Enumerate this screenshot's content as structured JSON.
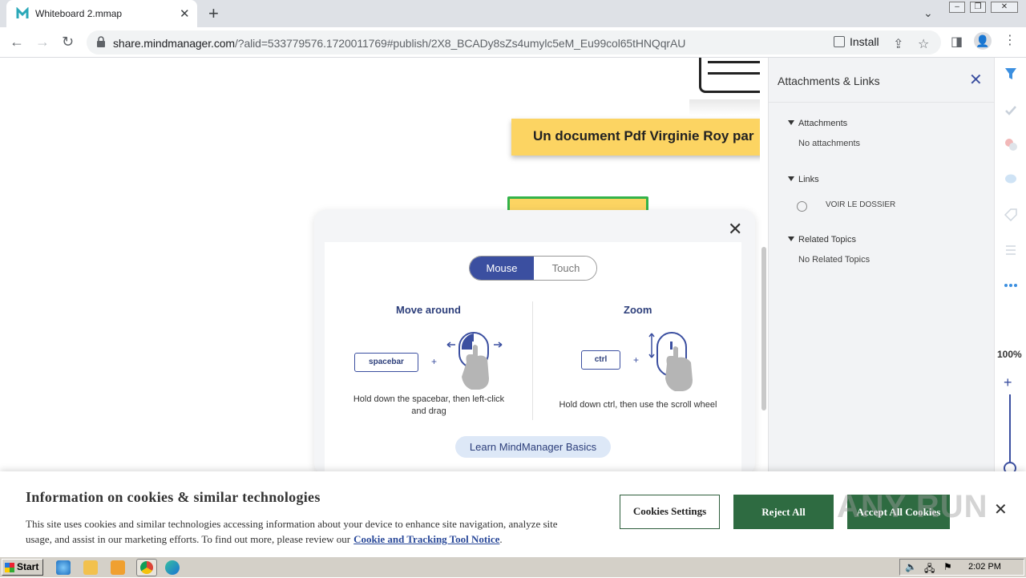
{
  "browser": {
    "tab_title": "Whiteboard 2.mmap",
    "url_host": "share.mindmanager.com",
    "url_rest": "/?alid=533779576.1720011769#publish/2X8_BCADy8sZs4umylc5eM_Eu99col65tHNQqrAU",
    "install_label": "Install"
  },
  "canvas": {
    "yellow_topic": "Un document Pdf Virginie Roy par"
  },
  "help": {
    "tabs": {
      "mouse": "Mouse",
      "touch": "Touch"
    },
    "move": {
      "title": "Move around",
      "key": "spacebar",
      "plus": "+",
      "desc": "Hold down the spacebar, then left-click and drag"
    },
    "zoom": {
      "title": "Zoom",
      "key": "ctrl",
      "plus": "+",
      "desc": "Hold down ctrl, then use the scroll wheel"
    },
    "learn_button": "Learn MindManager Basics"
  },
  "panel": {
    "title": "Attachments & Links",
    "sections": [
      {
        "label": "Attachments",
        "item": "No attachments"
      },
      {
        "label": "Links",
        "item": "VOIR LE DOSSIER"
      },
      {
        "label": "Related Topics",
        "item": "No Related Topics"
      }
    ]
  },
  "rail": {
    "zoom_level": "100%",
    "zoom_plus": "+"
  },
  "cookie": {
    "title": "Information on cookies & similar technologies",
    "text": "This site uses cookies and similar technologies accessing information about your device to enhance site navigation, analyze site usage, and assist in our marketing efforts. To find out more, please review our",
    "link": "Cookie and Tracking Tool Notice",
    "link_suffix": ".",
    "settings_button": "Cookies Settings",
    "reject_button": "Reject All",
    "accept_button": "Accept All Cookies",
    "watermark": "ANY RUN"
  },
  "taskbar": {
    "start_label": "Start",
    "clock": "2:02 PM"
  },
  "colors": {
    "brand_blue": "#3b4fa0",
    "cookie_green": "#2e6b41",
    "topic_yellow": "#fcd462",
    "topic_green_border": "#33b34a"
  }
}
